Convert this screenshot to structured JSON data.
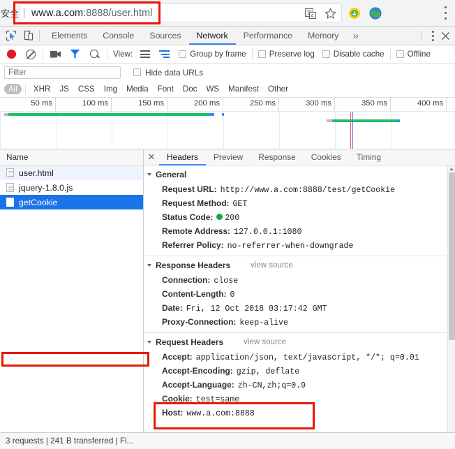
{
  "browser": {
    "secure_label": "安全",
    "url_main": "www.a.com",
    "url_rest": ":8888/user.html",
    "translate_icon": "translate-icon",
    "bookmark_icon": "star-icon",
    "menu_icon": "three-dot-menu-icon"
  },
  "devtools": {
    "tabs": [
      {
        "label": "Elements",
        "active": false
      },
      {
        "label": "Console",
        "active": false
      },
      {
        "label": "Sources",
        "active": false
      },
      {
        "label": "Network",
        "active": true
      },
      {
        "label": "Performance",
        "active": false
      },
      {
        "label": "Memory",
        "active": false
      }
    ],
    "more_tabs": "»",
    "inspect_icon": "inspect-cursor-icon",
    "device_icon": "device-toolbar-icon",
    "settings_icon": "three-dot-vertical-icon",
    "close_icon": "close-icon"
  },
  "toolbar": {
    "record_icon": "record-button",
    "clear_icon": "clear-icon",
    "screenshot_icon": "camera-icon",
    "filter_icon": "funnel-icon",
    "search_icon": "search-icon",
    "view_label": "View:",
    "list_view_icon": "list-view-icon",
    "waterfall_icon": "waterfall-view-icon",
    "group_by_frame": "Group by frame",
    "preserve_log": "Preserve log",
    "disable_cache": "Disable cache",
    "offline": "Offline"
  },
  "filter": {
    "placeholder": "Filter",
    "value": "",
    "hide_data_urls": "Hide data URLs",
    "types": [
      "All",
      "XHR",
      "JS",
      "CSS",
      "Img",
      "Media",
      "Font",
      "Doc",
      "WS",
      "Manifest",
      "Other"
    ],
    "active_type": "All"
  },
  "overview": {
    "ticks": [
      "50 ms",
      "100 ms",
      "150 ms",
      "200 ms",
      "250 ms",
      "300 ms",
      "350 ms",
      "400 ms"
    ],
    "bar_color": "#20bf6b",
    "tail_color": "#4285f4",
    "dom_event_color": "#4285f4",
    "load_event_color": "#e01b24"
  },
  "requests": {
    "column_header": "Name",
    "rows": [
      {
        "name": "user.html",
        "icon": "document-icon",
        "state": "alt"
      },
      {
        "name": "jquery-1.8.0.js",
        "icon": "document-icon",
        "state": "normal"
      },
      {
        "name": "getCookie",
        "icon": "blank-document-icon",
        "state": "selected"
      }
    ]
  },
  "details": {
    "close_icon": "close-icon",
    "tabs": [
      {
        "label": "Headers",
        "active": true
      },
      {
        "label": "Preview",
        "active": false
      },
      {
        "label": "Response",
        "active": false
      },
      {
        "label": "Cookies",
        "active": false
      },
      {
        "label": "Timing",
        "active": false
      }
    ],
    "general": {
      "title": "General",
      "items": [
        {
          "key": "Request URL:",
          "value": "http://www.a.com:8888/test/getCookie"
        },
        {
          "key": "Request Method:",
          "value": "GET"
        },
        {
          "key": "Status Code:",
          "value": "200",
          "status_dot": true
        },
        {
          "key": "Remote Address:",
          "value": "127.0.0.1:1080"
        },
        {
          "key": "Referrer Policy:",
          "value": "no-referrer-when-downgrade"
        }
      ]
    },
    "response_headers": {
      "title": "Response Headers",
      "view_source": "view source",
      "items": [
        {
          "key": "Connection:",
          "value": "close"
        },
        {
          "key": "Content-Length:",
          "value": "0"
        },
        {
          "key": "Date:",
          "value": "Fri, 12 Oct 2018 03:17:42 GMT"
        },
        {
          "key": "Proxy-Connection:",
          "value": "keep-alive"
        }
      ]
    },
    "request_headers": {
      "title": "Request Headers",
      "view_source": "view source",
      "items": [
        {
          "key": "Accept:",
          "value": "application/json, text/javascript, */*; q=0.01"
        },
        {
          "key": "Accept-Encoding:",
          "value": "gzip, deflate"
        },
        {
          "key": "Accept-Language:",
          "value": "zh-CN,zh;q=0.9"
        },
        {
          "key": "Cookie:",
          "value": "test=same"
        },
        {
          "key": "Host:",
          "value": "www.a.com:8888"
        }
      ]
    }
  },
  "statusbar": {
    "text": "3 requests | 241 B transferred | Fi..."
  },
  "annotations": {
    "color": "#e81800",
    "boxes": [
      "url-bar-highlight",
      "getcookie-row-highlight",
      "cookie-host-highlight"
    ]
  }
}
